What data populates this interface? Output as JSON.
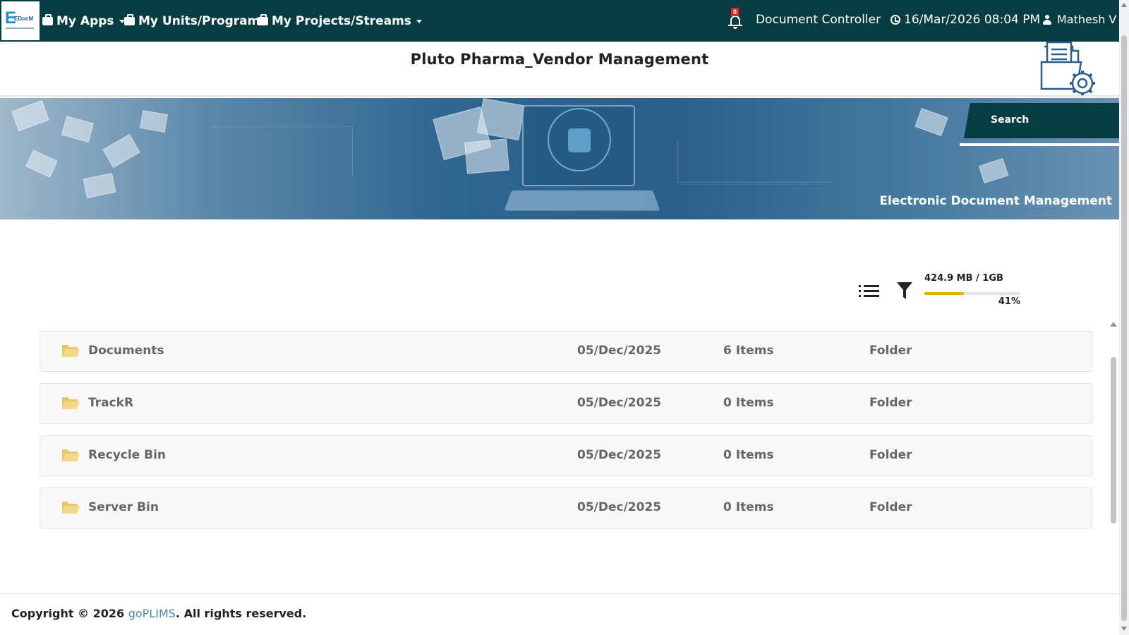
{
  "app": {
    "logo_text": "EDocM",
    "nav": {
      "my_apps": "My Apps",
      "my_units": "My Units/Programs",
      "my_projects": "My Projects/Streams"
    },
    "notifications_count": "0",
    "role": "Document Controller",
    "datetime": "16/Mar/2026 08:04 PM",
    "user": "Mathesh V"
  },
  "header": {
    "title": "Pluto Pharma_Vendor Management"
  },
  "banner": {
    "search_label": "Search",
    "caption": "Electronic Document Management"
  },
  "storage": {
    "used": "424.9 MB / 1GB",
    "percent_label": "41%",
    "percent": 41,
    "fill_color": "#f0a600"
  },
  "folders": [
    {
      "name": "Documents",
      "date": "05/Dec/2025",
      "count": "6 Items",
      "type": "Folder"
    },
    {
      "name": "TrackR",
      "date": "05/Dec/2025",
      "count": "0 Items",
      "type": "Folder"
    },
    {
      "name": "Recycle Bin",
      "date": "05/Dec/2025",
      "count": "0 Items",
      "type": "Folder"
    },
    {
      "name": "Server Bin",
      "date": "05/Dec/2025",
      "count": "0 Items",
      "type": "Folder"
    }
  ],
  "footer": {
    "prefix": "Copyright © 2026 ",
    "link": "goPLIMS",
    "suffix": ". All rights reserved."
  },
  "colors": {
    "navbar": "#073c43",
    "folder_icon": "#f3d88a",
    "link": "#4a8ab0"
  },
  "icons": [
    "briefcase-icon",
    "caret-down-icon",
    "bell-icon",
    "clock-icon",
    "user-icon",
    "document-settings-icon",
    "search-icon",
    "list-view-icon",
    "filter-icon",
    "folder-icon"
  ]
}
